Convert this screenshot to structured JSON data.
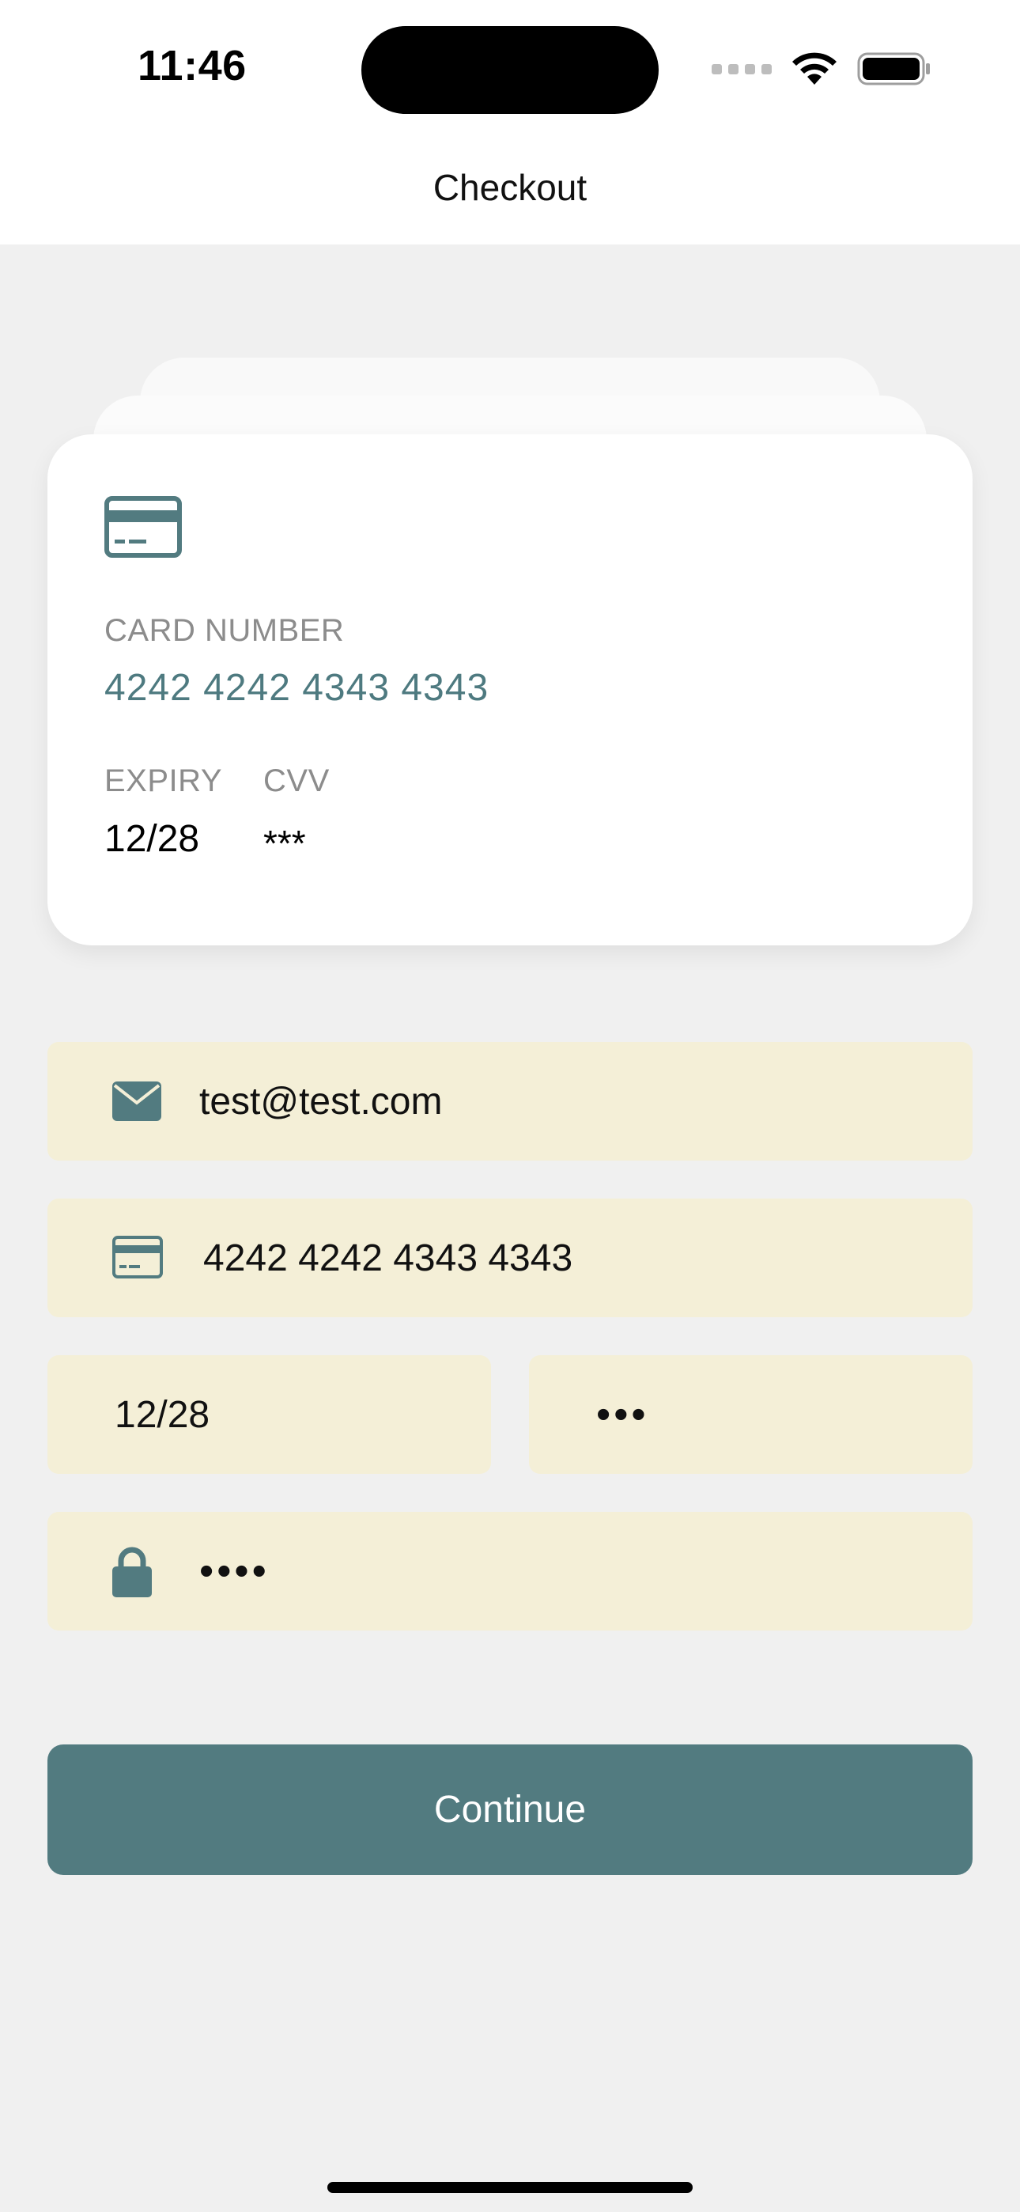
{
  "status_bar": {
    "time": "11:46",
    "icons": [
      "signal-icon",
      "wifi-icon",
      "battery-icon"
    ]
  },
  "nav": {
    "title": "Checkout"
  },
  "card_preview": {
    "icon": "credit-card-icon",
    "card_number_label": "CARD NUMBER",
    "card_number": "4242 4242 4343 4343",
    "expiry_label": "EXPIRY",
    "expiry": "12/28",
    "cvv_label": "CVV",
    "cvv": "***"
  },
  "form": {
    "email": {
      "icon": "envelope-icon",
      "value": "test@test.com"
    },
    "card_number": {
      "icon": "credit-card-icon",
      "value": "4242 4242 4343 4343"
    },
    "expiry": {
      "value": "12/28"
    },
    "cvv": {
      "value": "•••"
    },
    "pin": {
      "icon": "lock-icon",
      "value": "••••"
    }
  },
  "actions": {
    "continue_label": "Continue"
  },
  "colors": {
    "accent": "#527b80",
    "field_background": "#f4efd7",
    "page_background": "#f0f0f0",
    "card_number_text": "#4e7a80"
  }
}
